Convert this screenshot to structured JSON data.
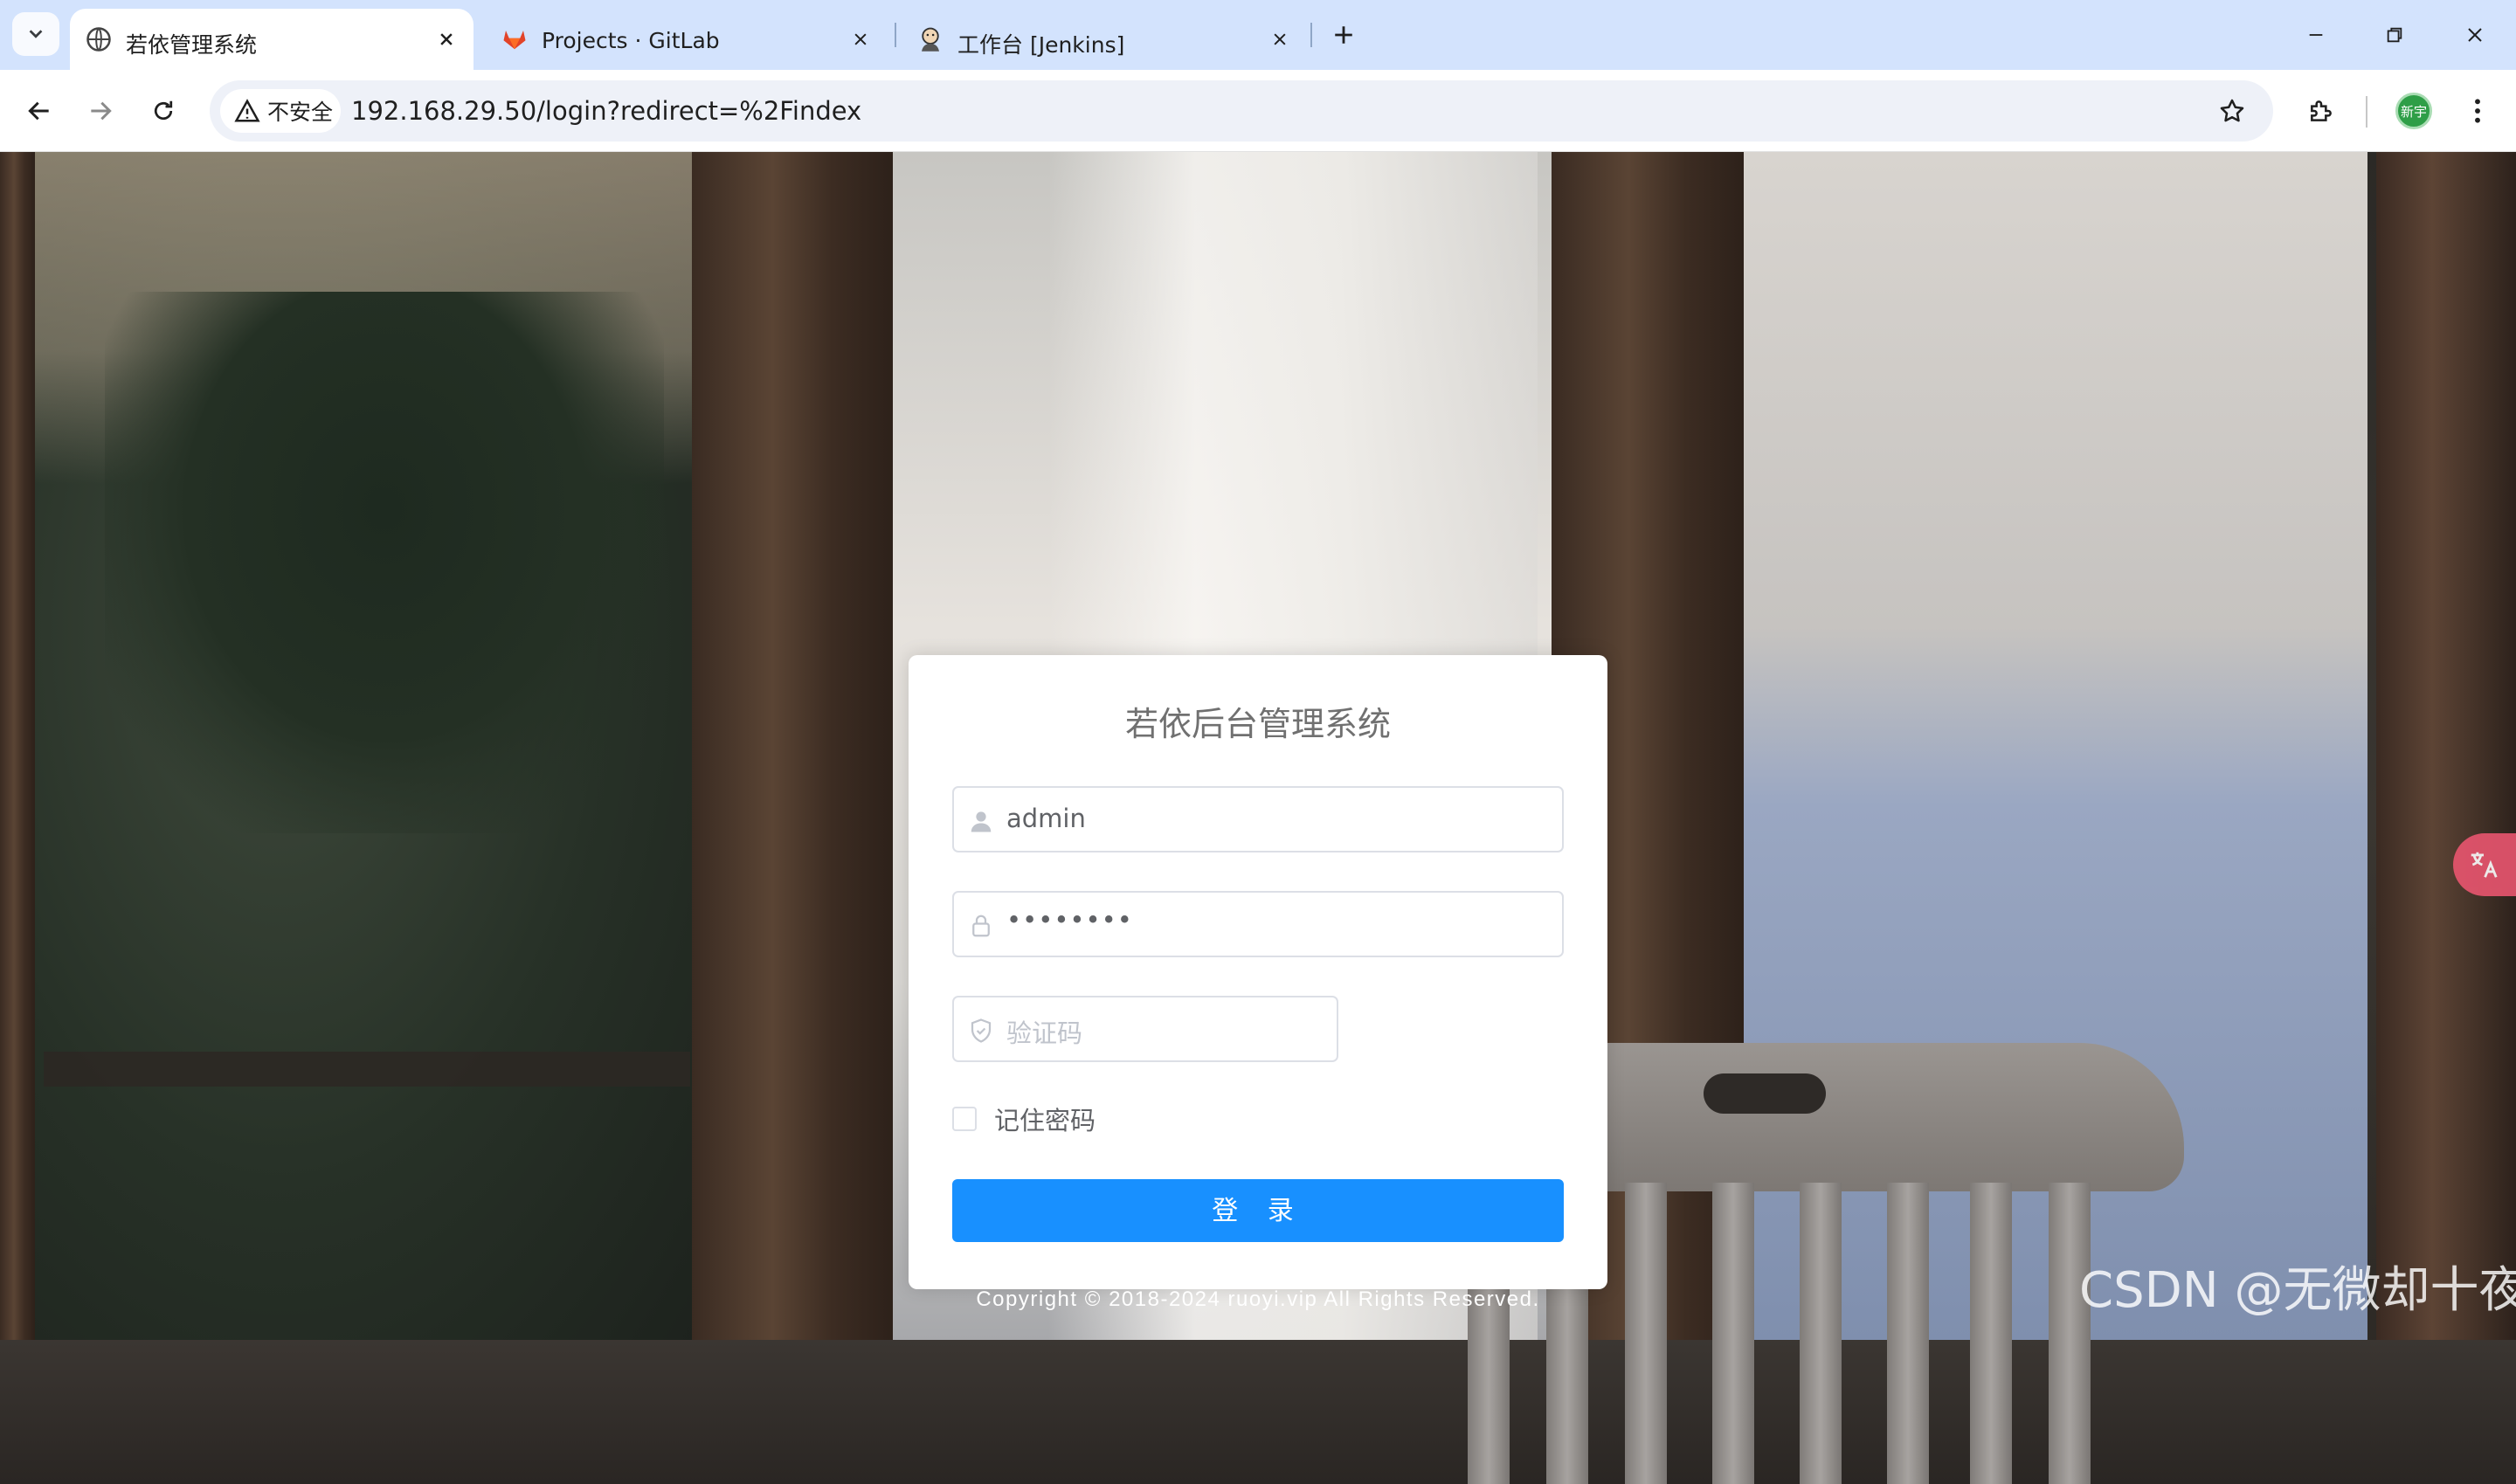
{
  "browser": {
    "tabs": [
      {
        "title": "若依管理系统",
        "active": true
      },
      {
        "title": "Projects · GitLab",
        "active": false
      },
      {
        "title": "工作台 [Jenkins]",
        "active": false
      }
    ],
    "security_label": "不安全",
    "url": "192.168.29.50/login?redirect=%2Findex",
    "profile_label": "新宇",
    "accent_color": "#d3e3fd"
  },
  "login": {
    "title": "若依后台管理系统",
    "username_value": "admin",
    "password_mask": "••••••••",
    "captcha_placeholder": "验证码",
    "remember_label": "记住密码",
    "remember_checked": false,
    "submit_label": "登 录",
    "button_color": "#1890ff"
  },
  "footer": {
    "copyright": "Copyright © 2018-2024 ruoyi.vip All Rights Reserved."
  },
  "watermark": "CSDN @无微却十夜",
  "icons": {
    "username": "user-icon",
    "password": "lock-icon",
    "captcha": "shield-icon",
    "translate": "translate-icon"
  }
}
